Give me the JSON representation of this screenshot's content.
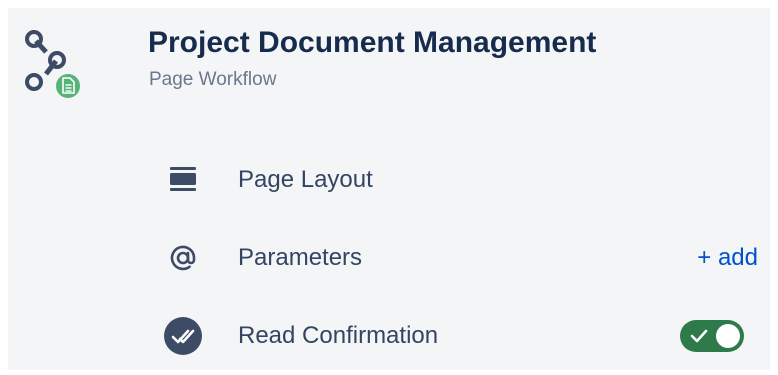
{
  "header": {
    "title": "Project Document Management",
    "subtitle": "Page Workflow",
    "app_icon": "workflow-document-icon"
  },
  "items": [
    {
      "label": "Page Layout",
      "icon": "layout-icon"
    },
    {
      "label": "Parameters",
      "icon": "at-sign-icon",
      "action": "+ add"
    },
    {
      "label": "Read Confirmation",
      "icon": "double-check-icon",
      "toggle_on": true
    }
  ],
  "colors": {
    "title": "#172b4d",
    "subtitle": "#6b778c",
    "label": "#344563",
    "link": "#0052cc",
    "toggle_on": "#2f7a4b",
    "badge": "#57b37a",
    "icon_dark": "#3d4b66"
  }
}
